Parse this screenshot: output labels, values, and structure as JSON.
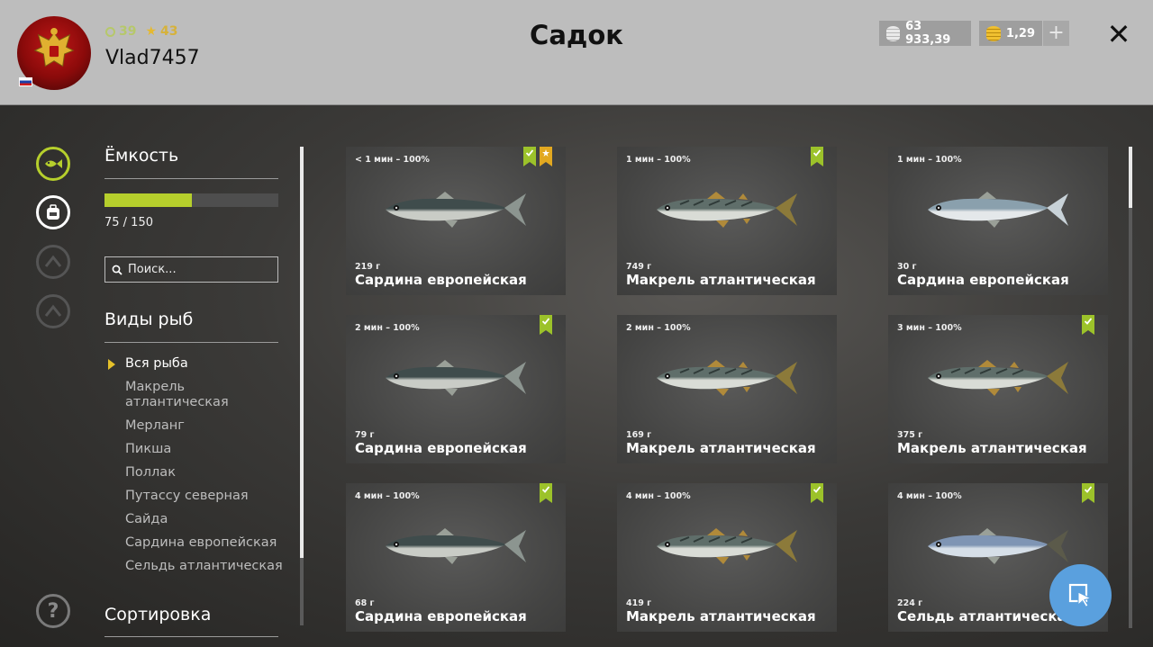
{
  "header": {
    "title": "Садок",
    "username": "Vlad7457",
    "level": "39",
    "rank": "43",
    "silver": "63 933,39",
    "gold": "1,29",
    "plus": "+",
    "close": "✕"
  },
  "sidebar": {
    "capacity_label": "Ёмкость",
    "capacity_current": 75,
    "capacity_max": 150,
    "capacity_text": "75 / 150",
    "search_placeholder": "Поиск...",
    "species_label": "Виды рыб",
    "species": [
      "Вся рыба",
      "Макрель атлантическая",
      "Мерланг",
      "Пикша",
      "Поллак",
      "Путассу северная",
      "Сайда",
      "Сардина европейская",
      "Сельдь атлантическая"
    ],
    "sort_label": "Сортировка",
    "help": "?"
  },
  "fish": [
    {
      "time": "< 1 мин – 100%",
      "weight": "219 г",
      "name": "Сардина европейская",
      "kind": "sardine",
      "badges": [
        "green",
        "gold"
      ]
    },
    {
      "time": "1 мин – 100%",
      "weight": "749 г",
      "name": "Макрель атлантическая",
      "kind": "mackerel",
      "badges": [
        "green"
      ]
    },
    {
      "time": "1 мин – 100%",
      "weight": "30 г",
      "name": "Сардина европейская",
      "kind": "sardine-light",
      "badges": []
    },
    {
      "time": "2 мин – 100%",
      "weight": "79 г",
      "name": "Сардина европейская",
      "kind": "sardine",
      "badges": [
        "green"
      ]
    },
    {
      "time": "2 мин – 100%",
      "weight": "169 г",
      "name": "Макрель атлантическая",
      "kind": "mackerel",
      "badges": []
    },
    {
      "time": "3 мин – 100%",
      "weight": "375 г",
      "name": "Макрель атлантическая",
      "kind": "mackerel",
      "badges": [
        "green"
      ]
    },
    {
      "time": "4 мин – 100%",
      "weight": "68 г",
      "name": "Сардина европейская",
      "kind": "sardine",
      "badges": [
        "green"
      ]
    },
    {
      "time": "4 мин – 100%",
      "weight": "419 г",
      "name": "Макрель атлантическая",
      "kind": "mackerel",
      "badges": [
        "green"
      ]
    },
    {
      "time": "4 мин – 100%",
      "weight": "224 г",
      "name": "Сельдь атлантическая",
      "kind": "herring",
      "badges": [
        "green"
      ]
    }
  ],
  "colors": {
    "accent_green": "#b6cf2c",
    "badge_green": "#9cc22a",
    "badge_gold": "#e2a820",
    "fab_blue": "#5aa0de"
  }
}
